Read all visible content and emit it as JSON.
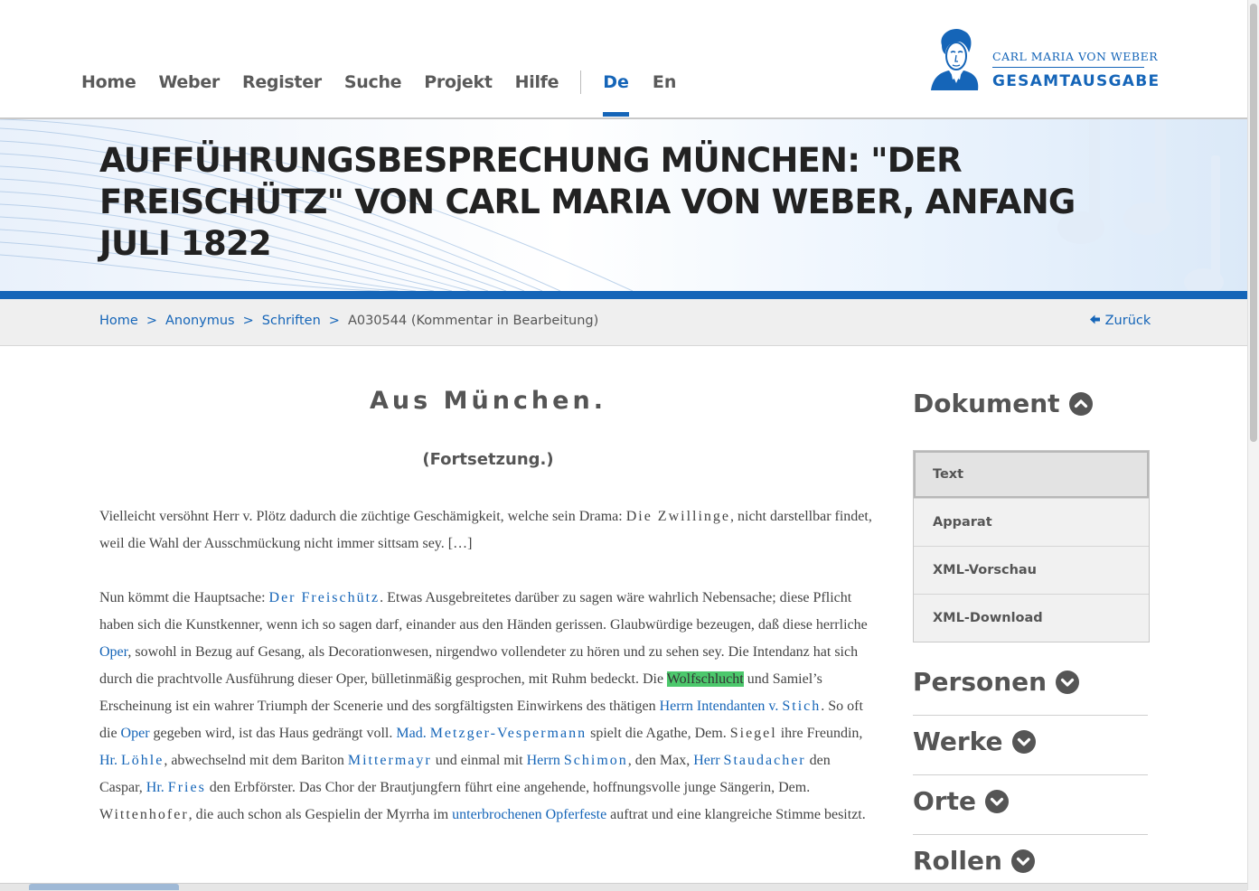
{
  "nav": {
    "items": [
      "Home",
      "Weber",
      "Register",
      "Suche",
      "Projekt",
      "Hilfe"
    ],
    "languages": [
      {
        "label": "De",
        "active": true
      },
      {
        "label": "En",
        "active": false
      }
    ]
  },
  "logo": {
    "line1": "CARL MARIA VON WEBER",
    "line2": "GESAMTAUSGABE"
  },
  "page_title": "Aufführungsbesprechung München: \"Der Freischütz\" von Carl Maria von Weber, Anfang Juli 1822",
  "breadcrumb": {
    "items": [
      "Home",
      "Anonymus",
      "Schriften"
    ],
    "separator": ">",
    "current": "A030544 (Kommentar in Bearbeitung)",
    "back_label": "Zurück"
  },
  "document": {
    "heading": "Aus München.",
    "subheading": "(Fortsetzung.)",
    "p1": {
      "t1": "Vielleicht versöhnt Herr v. Plötz dadurch die züchtige Geschämigkeit, welche sein Drama: ",
      "s1": "Die Zwillinge",
      "t2": ", nicht darstellbar findet, weil die Wahl der Ausschmückung nicht immer sittsam sey. […]"
    },
    "p2": {
      "t1": "Nun kömmt die Hauptsache: ",
      "l_freischuetz": "Der Freischütz",
      "t2": ". Etwas Ausgebreitetes darüber zu sagen wäre wahrlich Nebensache; diese Pflicht haben sich die Kunstkenner, wenn ich so sagen darf, einander aus den Händen gerissen. Glaubwürdige bezeugen, daß diese herrliche ",
      "l_oper1": "Oper",
      "t3": ", sowohl in Bezug auf Gesang, als Decorationwesen, nirgendwo vollendeter zu hören und zu sehen sey. Die Intendanz hat sich durch die prachtvolle Ausführung dieser Oper, bülletinmäßig gesprochen, mit Ruhm bedeckt. Die ",
      "hl_wolfschlucht": "Wolfschlucht",
      "t4": " und Samiel’s Erscheinung ist ein wahrer Triumph der Scenerie und des sorgfältigsten Einwirkens des thätigen ",
      "l_intendant_a": "Herrn Intendanten v. ",
      "l_intendant_b": "Stich",
      "t5": ". So oft die ",
      "l_oper2": "Oper",
      "t6": " gegeben wird, ist das Haus gedrängt voll. ",
      "l_mad": "Mad.",
      "t6b": " ",
      "l_metzger": "Metzger-Vespermann",
      "t7": " spielt die Agathe, Dem. ",
      "s_siegel": "Siegel",
      "t8": " ihre Freundin, ",
      "l_loehle_a": "Hr. ",
      "l_loehle_b": "Löhle",
      "t9": ", abwechselnd mit dem Bariton ",
      "l_mittermayr": "Mittermayr",
      "t10": " und einmal mit ",
      "l_schimon_a": "Herrn ",
      "l_schimon_b": "Schimon",
      "t11": ", den Max, ",
      "l_staudacher_a": "Herr ",
      "l_staudacher_b": "Staudacher",
      "t12": " den Caspar, ",
      "l_fries_a": "Hr. ",
      "l_fries_b": "Fries",
      "t13": " den Erbförster. Das Chor der Brautjungfern führt eine angehende, hoffnungsvolle junge Sängerin, Dem. ",
      "s_wittenhofer": "Wittenhofer",
      "t14": ", die auch schon als Gespielin der Myrrha im ",
      "l_opferfeste": "unterbrochenen Opferfeste",
      "t15": " auftrat und eine klangreiche Stimme besitzt."
    }
  },
  "sidebar": {
    "dokument": {
      "title": "Dokument",
      "expanded": true,
      "items": [
        {
          "label": "Text",
          "active": true
        },
        {
          "label": "Apparat",
          "active": false
        },
        {
          "label": "XML-Vorschau",
          "active": false
        },
        {
          "label": "XML-Download",
          "active": false
        }
      ]
    },
    "sections": [
      "Personen",
      "Werke",
      "Orte",
      "Rollen"
    ]
  },
  "colors": {
    "brand_blue": "#1565b8",
    "highlight_green": "#4cc86c",
    "text_grey": "#555555"
  }
}
